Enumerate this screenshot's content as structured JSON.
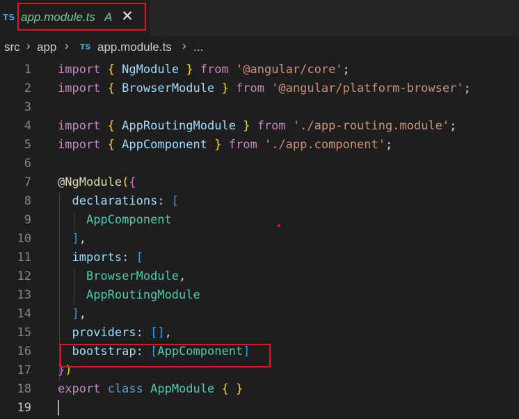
{
  "tab": {
    "lang_badge": "TS",
    "filename": "app.module.ts",
    "git_status": "A",
    "close_glyph": "✕"
  },
  "breadcrumb": {
    "items": [
      "src",
      "app",
      "app.module.ts",
      "..."
    ],
    "separator": "›",
    "file_badge": "TS"
  },
  "editor": {
    "lines": [
      {
        "n": "1",
        "tokens": [
          [
            "kw",
            "import"
          ],
          [
            "plain",
            " "
          ],
          [
            "br1",
            "{"
          ],
          [
            "plain",
            " "
          ],
          [
            "id",
            "NgModule"
          ],
          [
            "plain",
            " "
          ],
          [
            "br1",
            "}"
          ],
          [
            "plain",
            " "
          ],
          [
            "kw",
            "from"
          ],
          [
            "plain",
            " "
          ],
          [
            "str",
            "'@angular/core'"
          ],
          [
            "plain",
            ";"
          ]
        ]
      },
      {
        "n": "2",
        "tokens": [
          [
            "kw",
            "import"
          ],
          [
            "plain",
            " "
          ],
          [
            "br1",
            "{"
          ],
          [
            "plain",
            " "
          ],
          [
            "id",
            "BrowserModule"
          ],
          [
            "plain",
            " "
          ],
          [
            "br1",
            "}"
          ],
          [
            "plain",
            " "
          ],
          [
            "kw",
            "from"
          ],
          [
            "plain",
            " "
          ],
          [
            "str",
            "'@angular/platform-browser'"
          ],
          [
            "plain",
            ";"
          ]
        ]
      },
      {
        "n": "3",
        "tokens": []
      },
      {
        "n": "4",
        "tokens": [
          [
            "kw",
            "import"
          ],
          [
            "plain",
            " "
          ],
          [
            "br1",
            "{"
          ],
          [
            "plain",
            " "
          ],
          [
            "id",
            "AppRoutingModule"
          ],
          [
            "plain",
            " "
          ],
          [
            "br1",
            "}"
          ],
          [
            "plain",
            " "
          ],
          [
            "kw",
            "from"
          ],
          [
            "plain",
            " "
          ],
          [
            "str",
            "'./app-routing.module'"
          ],
          [
            "plain",
            ";"
          ]
        ]
      },
      {
        "n": "5",
        "tokens": [
          [
            "kw",
            "import"
          ],
          [
            "plain",
            " "
          ],
          [
            "br1",
            "{"
          ],
          [
            "plain",
            " "
          ],
          [
            "id",
            "AppComponent"
          ],
          [
            "plain",
            " "
          ],
          [
            "br1",
            "}"
          ],
          [
            "plain",
            " "
          ],
          [
            "kw",
            "from"
          ],
          [
            "plain",
            " "
          ],
          [
            "str",
            "'./app.component'"
          ],
          [
            "plain",
            ";"
          ]
        ]
      },
      {
        "n": "6",
        "tokens": []
      },
      {
        "n": "7",
        "tokens": [
          [
            "plain",
            "@"
          ],
          [
            "fn",
            "NgModule"
          ],
          [
            "br1",
            "("
          ],
          [
            "br2",
            "{"
          ]
        ]
      },
      {
        "n": "8",
        "tokens": [
          [
            "plain",
            "  "
          ],
          [
            "id",
            "declarations"
          ],
          [
            "plain",
            ": "
          ],
          [
            "br3",
            "["
          ]
        ]
      },
      {
        "n": "9",
        "tokens": [
          [
            "plain",
            "    "
          ],
          [
            "cls",
            "AppComponent"
          ]
        ]
      },
      {
        "n": "10",
        "tokens": [
          [
            "plain",
            "  "
          ],
          [
            "br3",
            "]"
          ],
          [
            "plain",
            ","
          ]
        ]
      },
      {
        "n": "11",
        "tokens": [
          [
            "plain",
            "  "
          ],
          [
            "id",
            "imports"
          ],
          [
            "plain",
            ": "
          ],
          [
            "br3",
            "["
          ]
        ]
      },
      {
        "n": "12",
        "tokens": [
          [
            "plain",
            "    "
          ],
          [
            "cls",
            "BrowserModule"
          ],
          [
            "plain",
            ","
          ]
        ]
      },
      {
        "n": "13",
        "tokens": [
          [
            "plain",
            "    "
          ],
          [
            "cls",
            "AppRoutingModule"
          ]
        ]
      },
      {
        "n": "14",
        "tokens": [
          [
            "plain",
            "  "
          ],
          [
            "br3",
            "]"
          ],
          [
            "plain",
            ","
          ]
        ]
      },
      {
        "n": "15",
        "tokens": [
          [
            "plain",
            "  "
          ],
          [
            "id",
            "providers"
          ],
          [
            "plain",
            ": "
          ],
          [
            "br3",
            "[]"
          ],
          [
            "plain",
            ","
          ]
        ]
      },
      {
        "n": "16",
        "tokens": [
          [
            "plain",
            "  "
          ],
          [
            "id",
            "bootstrap"
          ],
          [
            "plain",
            ": "
          ],
          [
            "br3",
            "["
          ],
          [
            "cls",
            "AppComponent"
          ],
          [
            "br3",
            "]"
          ]
        ]
      },
      {
        "n": "17",
        "tokens": [
          [
            "br2",
            "}"
          ],
          [
            "br1",
            ")"
          ]
        ]
      },
      {
        "n": "18",
        "tokens": [
          [
            "kw",
            "export"
          ],
          [
            "plain",
            " "
          ],
          [
            "kw2",
            "class"
          ],
          [
            "plain",
            " "
          ],
          [
            "cls",
            "AppModule"
          ],
          [
            "plain",
            " "
          ],
          [
            "br1",
            "{"
          ],
          [
            "plain",
            " "
          ],
          [
            "br1",
            "}"
          ]
        ]
      },
      {
        "n": "19",
        "tokens": []
      }
    ],
    "active_line": "19"
  },
  "colors": {
    "highlight_box": "#e81123",
    "added_file": "#73c991",
    "ts_badge": "#4aa3e0"
  }
}
